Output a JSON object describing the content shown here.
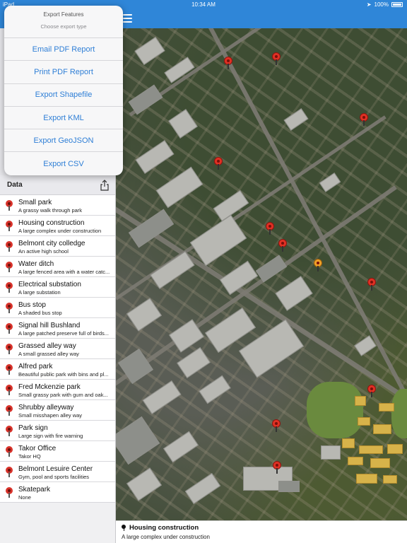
{
  "status_bar": {
    "carrier": "iPad",
    "time": "10:34 AM",
    "battery": "100%"
  },
  "export_popover": {
    "title": "Export Features",
    "subtitle": "Choose export type",
    "options": [
      "Email PDF Report",
      "Print PDF Report",
      "Export Shapefile",
      "Export KML",
      "Export GeoJSON",
      "Export CSV"
    ]
  },
  "data_panel": {
    "title": "Data",
    "items": [
      {
        "name": "Small park",
        "description": "A grassy walk through park"
      },
      {
        "name": "Housing construction",
        "description": "A large complex under construction"
      },
      {
        "name": "Belmont city colledge",
        "description": "An active high school"
      },
      {
        "name": "Water ditch",
        "description": "A large fenced area with a water catc..."
      },
      {
        "name": "Electrical substation",
        "description": "A large substation"
      },
      {
        "name": "Bus stop",
        "description": "A shaded bus stop"
      },
      {
        "name": "Signal hill Bushland",
        "description": "A large patched preserve full of birds..."
      },
      {
        "name": "Grassed alley way",
        "description": "A small grassed alley way"
      },
      {
        "name": "Alfred park",
        "description": "Beautiful public park with bins and pl..."
      },
      {
        "name": "Fred Mckenzie park",
        "description": "Small grassy park with gum and oak..."
      },
      {
        "name": "Shrubby alleyway",
        "description": "Small misshapen alley way"
      },
      {
        "name": "Park sign",
        "description": "Large sign with fire warning"
      },
      {
        "name": "Takor Office",
        "description": "Takor HQ"
      },
      {
        "name": "Belmont Lesuire Center",
        "description": "Gym, pool and sports facilities"
      },
      {
        "name": "Skatepark",
        "description": "None"
      }
    ]
  },
  "selected_feature": {
    "name": "Housing construction",
    "description": "A large complex under construction"
  },
  "colors": {
    "nav_blue": "#2f86d8",
    "link_blue": "#2f7fd6",
    "pin_red": "#e03124",
    "pin_selected": "#f0a22a"
  },
  "icons": {
    "menu": "hamburger-icon",
    "share": "share-icon",
    "pin": "map-pin-icon"
  }
}
